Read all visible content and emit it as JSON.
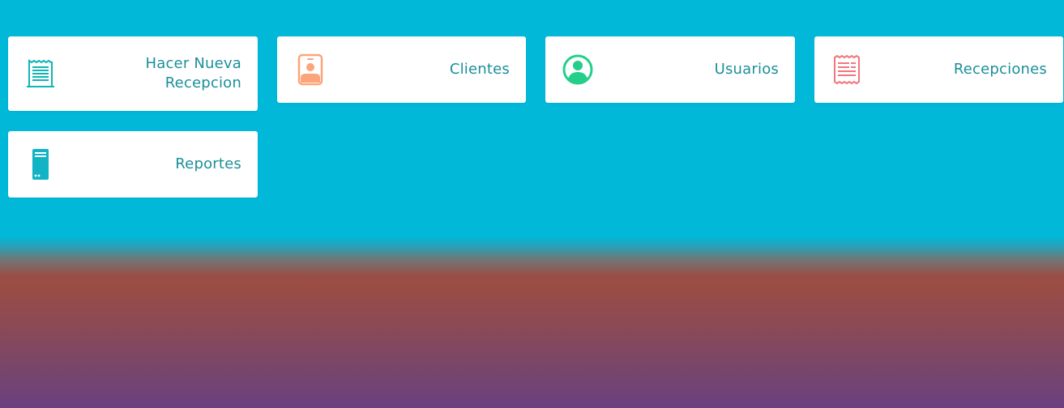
{
  "menu": {
    "cards": [
      {
        "label": "Hacer Nueva\nRecepcion",
        "icon": "receipt-icon",
        "color": "#10b5b5"
      },
      {
        "label": "Clientes",
        "icon": "id-badge-icon",
        "color": "#fba57b"
      },
      {
        "label": "Usuarios",
        "icon": "user-circle-icon",
        "color": "#23cf8a"
      },
      {
        "label": "Recepciones",
        "icon": "receipt-zigzag-icon",
        "color": "#f2767f"
      },
      {
        "label": "Reportes",
        "icon": "server-icon",
        "color": "#11b4c4"
      }
    ]
  },
  "theme": {
    "background_top": "#01b8d8",
    "background_bottom": "#6a4080",
    "label_color": "#1b8f99"
  }
}
